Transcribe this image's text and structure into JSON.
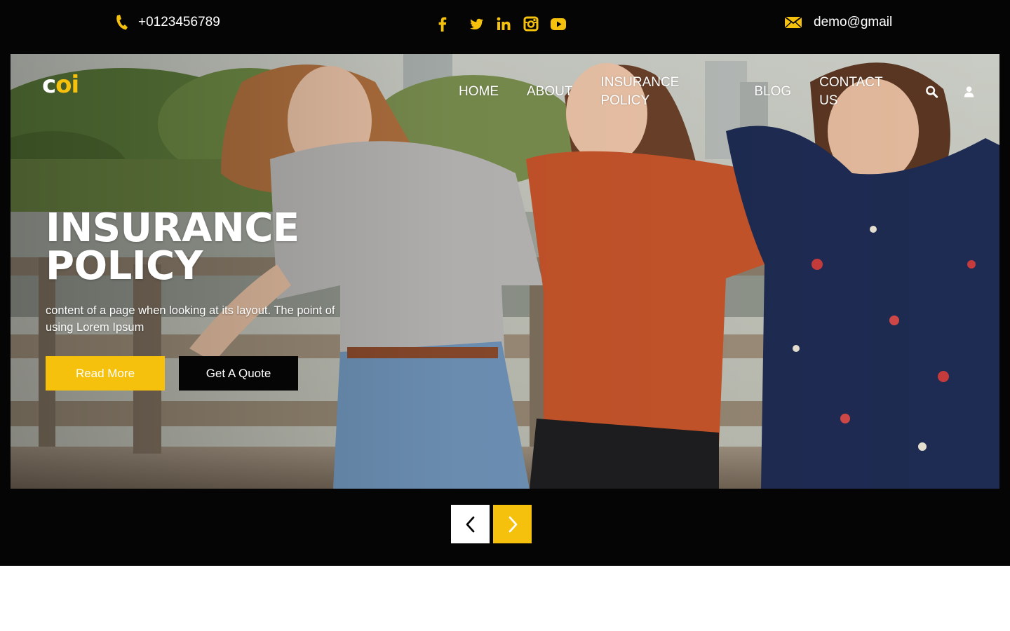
{
  "topbar": {
    "phone": "+0123456789",
    "email": "demo@gmail",
    "social": [
      "facebook-icon",
      "twitter-icon",
      "linkedin-icon",
      "instagram-icon",
      "youtube-icon"
    ]
  },
  "header": {
    "logo_part1": "c",
    "logo_part2": "oi",
    "nav": [
      "HOME",
      "ABOUT",
      "INSURANCE POLICY",
      "BLOG",
      "CONTACT US"
    ],
    "icons": [
      "search-icon",
      "user-icon"
    ]
  },
  "hero": {
    "title_line1": "INSURANCE",
    "title_line2": "POLICY",
    "subtitle": "content of a page when looking at its layout. The point of using Lorem Ipsum",
    "read_more": "Read More",
    "get_quote": "Get A Quote"
  },
  "slider": {
    "prev": "chevron-left-icon",
    "next": "chevron-right-icon"
  },
  "colors": {
    "accent": "#f5c10c",
    "dark": "#050505",
    "text": "#ffffff"
  }
}
